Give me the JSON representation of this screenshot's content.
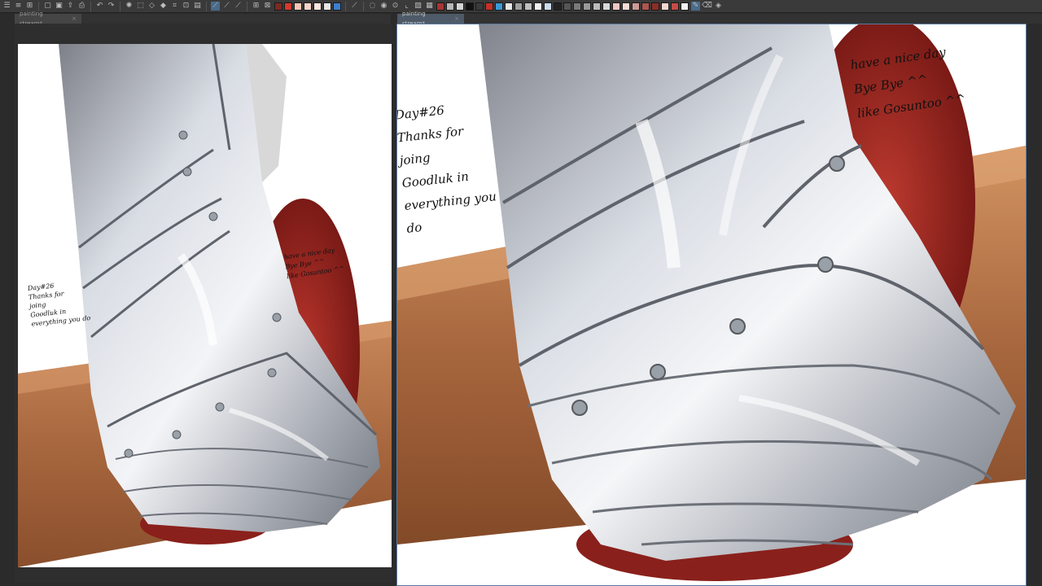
{
  "toolbar": {
    "icons": [
      "menu-icon",
      "list-icon",
      "ruler-icon",
      "new-file-icon",
      "save-icon",
      "export-icon",
      "print-icon",
      "undo-icon",
      "redo-icon",
      "spinner-icon",
      "transform-icon",
      "clear-icon",
      "fill-icon",
      "crop-icon",
      "selection-icon",
      "layer-icon",
      "pen-icon",
      "pen-active-icon",
      "brush-icon",
      "grid-icon",
      "ruler2-icon"
    ],
    "colors_a": [
      "#7b2a22",
      "#d23b2c",
      "#f3c7b4",
      "#f5d4c8",
      "#fde7de",
      "#e6e6e6",
      "#3b7fd1"
    ],
    "colors_b": [
      "#a33",
      "#b8b8b8",
      "#d4d4d4",
      "#111111",
      "#3a3a3a",
      "#c23128",
      "#3a99d4",
      "#e6e6e6",
      "#a0a0a0",
      "#bfbfbf",
      "#f1f1f1",
      "#ccddee",
      "#222222",
      "#555555",
      "#7a7a7a",
      "#999999",
      "#bcbcbc",
      "#d8d8d8",
      "#efc7c0",
      "#f5dcd6",
      "#cc9a95",
      "#ab5550",
      "#8a2d27",
      "#f0d8d0",
      "#c64b45",
      "#f2f2f2"
    ]
  },
  "left_panel": {
    "tab_label": "painting stream*",
    "tab_close": "×",
    "note_left": [
      "Day#26",
      "Thanks for",
      "joing",
      "Goodluk in",
      "everything you do"
    ],
    "note_right": [
      "have a nice day",
      "Bye Bye ^^",
      "like Gosuntoo ^^"
    ]
  },
  "right_panel": {
    "tab_label": "painting stream*",
    "tab_close": "×",
    "note_left": [
      "Day#26",
      "Thanks for",
      "joing",
      "Goodluk in",
      "everything you do"
    ],
    "note_right": [
      "have a nice day",
      "Bye Bye ^^",
      "like Gosuntoo ^^"
    ]
  }
}
